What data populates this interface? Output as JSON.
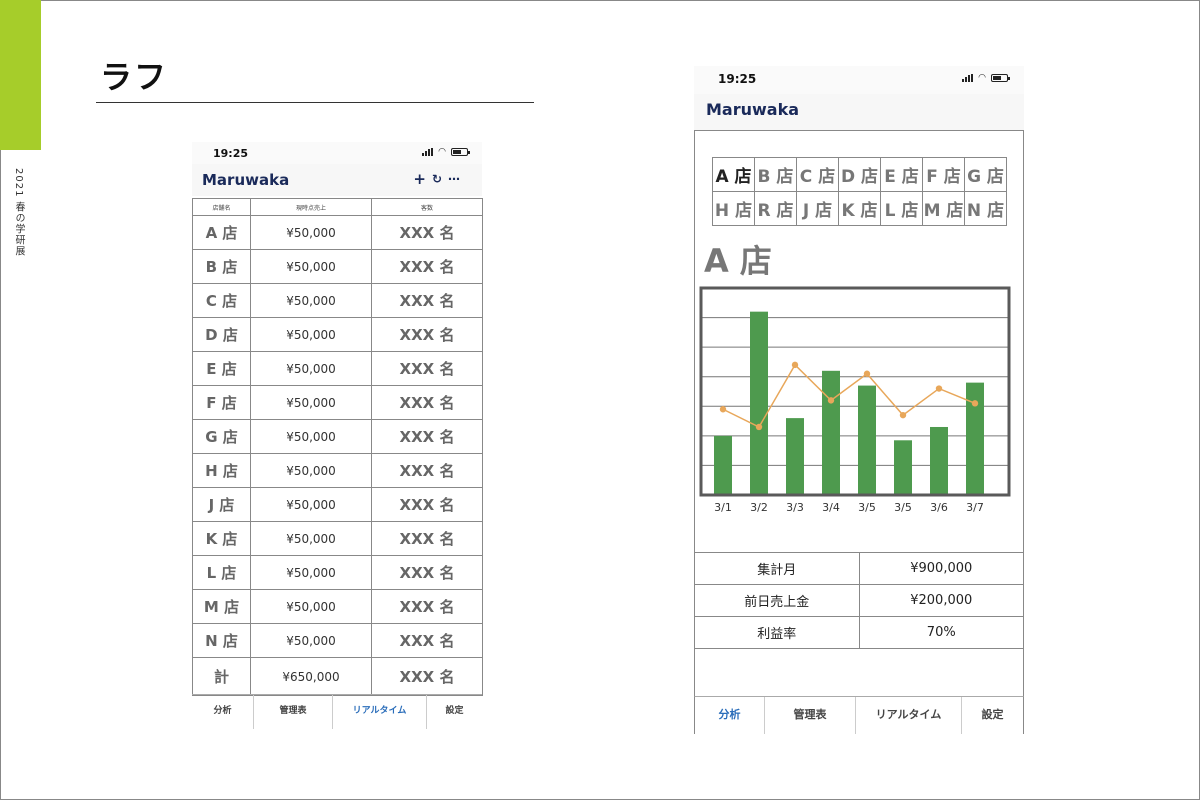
{
  "page": {
    "title": "ラフ",
    "side_label": "2021 春の学研展"
  },
  "colors": {
    "accent": "#a6cd2a",
    "brand": "#1a2a5a",
    "active_tab": "#2a6dba",
    "bar": "#4e9a4e",
    "line": "#e8a75a"
  },
  "phone_list": {
    "status_time": "19:25",
    "brand": "Maruwaka",
    "actions": [
      "+",
      "↻",
      "⋯"
    ],
    "table_headers": [
      "店舗名",
      "現時点売上",
      "客数"
    ],
    "rows": [
      {
        "store": "A 店",
        "sales": "¥50,000",
        "customers": "XXX 名"
      },
      {
        "store": "B 店",
        "sales": "¥50,000",
        "customers": "XXX 名"
      },
      {
        "store": "C 店",
        "sales": "¥50,000",
        "customers": "XXX 名"
      },
      {
        "store": "D 店",
        "sales": "¥50,000",
        "customers": "XXX 名"
      },
      {
        "store": "E 店",
        "sales": "¥50,000",
        "customers": "XXX 名"
      },
      {
        "store": "F 店",
        "sales": "¥50,000",
        "customers": "XXX 名"
      },
      {
        "store": "G 店",
        "sales": "¥50,000",
        "customers": "XXX 名"
      },
      {
        "store": "H 店",
        "sales": "¥50,000",
        "customers": "XXX 名"
      },
      {
        "store": "J 店",
        "sales": "¥50,000",
        "customers": "XXX 名"
      },
      {
        "store": "K 店",
        "sales": "¥50,000",
        "customers": "XXX 名"
      },
      {
        "store": "L 店",
        "sales": "¥50,000",
        "customers": "XXX 名"
      },
      {
        "store": "M 店",
        "sales": "¥50,000",
        "customers": "XXX 名"
      },
      {
        "store": "N 店",
        "sales": "¥50,000",
        "customers": "XXX 名"
      }
    ],
    "total": {
      "store": "計",
      "sales": "¥650,000",
      "customers": "XXX 名"
    },
    "tabs": [
      "分析",
      "管理表",
      "リアルタイム",
      "設定"
    ],
    "active_tab": "リアルタイム"
  },
  "phone_detail": {
    "status_time": "19:25",
    "brand": "Maruwaka",
    "stores_row1": [
      "A 店",
      "B 店",
      "C 店",
      "D 店",
      "E 店",
      "F 店",
      "G 店"
    ],
    "stores_row2": [
      "H 店",
      "R 店",
      "J 店",
      "K 店",
      "L 店",
      "M 店",
      "N 店"
    ],
    "selected_store": "A 店",
    "summary": [
      {
        "label": "集計月",
        "value": "¥900,000"
      },
      {
        "label": "前日売上金",
        "value": "¥200,000"
      },
      {
        "label": "利益率",
        "value": "70%"
      }
    ],
    "tabs": [
      "分析",
      "管理表",
      "リアルタイム",
      "設定"
    ],
    "active_tab": "分析"
  },
  "chart_data": {
    "type": "bar",
    "categories": [
      "3/1",
      "3/2",
      "3/3",
      "3/4",
      "3/5",
      "3/5",
      "3/6",
      "3/7"
    ],
    "series": [
      {
        "type": "bar",
        "values": [
          2.0,
          6.2,
          2.6,
          4.2,
          3.7,
          1.85,
          2.3,
          3.8
        ]
      },
      {
        "type": "line",
        "values": [
          2.9,
          2.3,
          4.4,
          3.2,
          4.1,
          2.7,
          3.6,
          3.1
        ]
      }
    ],
    "ylim": [
      0,
      7
    ],
    "grid": true,
    "legend": "none"
  }
}
